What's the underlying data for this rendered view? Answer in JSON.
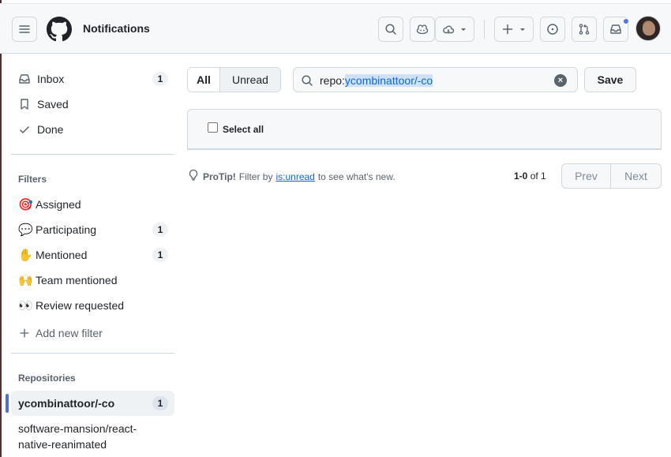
{
  "header": {
    "title": "Notifications"
  },
  "sidebar": {
    "inbox": {
      "label": "Inbox",
      "count": "1"
    },
    "saved": {
      "label": "Saved"
    },
    "done": {
      "label": "Done"
    },
    "filters_heading": "Filters",
    "filters": [
      {
        "emoji": "🎯",
        "label": "Assigned",
        "count": ""
      },
      {
        "emoji": "💬",
        "label": "Participating",
        "count": "1"
      },
      {
        "emoji": "✋",
        "label": "Mentioned",
        "count": "1"
      },
      {
        "emoji": "🙌",
        "label": "Team mentioned",
        "count": ""
      },
      {
        "emoji": "👀",
        "label": "Review requested",
        "count": ""
      }
    ],
    "add_filter_label": "Add new filter",
    "repositories_heading": "Repositories",
    "repositories": [
      {
        "label": "ycombinattoor/-co",
        "count": "1"
      },
      {
        "label": "software-mansion/react-native-reanimated",
        "count": ""
      }
    ]
  },
  "toolbar": {
    "tab_all": "All",
    "tab_unread": "Unread",
    "search_prefix": "repo:",
    "search_value": "ycombinattoor/-co",
    "save_label": "Save"
  },
  "list": {
    "select_all_label": "Select all"
  },
  "footer": {
    "protip_bold": "ProTip!",
    "protip_before": "Filter by",
    "protip_link": "is:unread",
    "protip_after": "to see what's new.",
    "range": "1-0",
    "of_label": "of 1",
    "prev_label": "Prev",
    "next_label": "Next"
  },
  "colors": {
    "accent": "#0969da",
    "active_bar": "#4f6fd6",
    "notification_dot": "#4f78e0"
  }
}
